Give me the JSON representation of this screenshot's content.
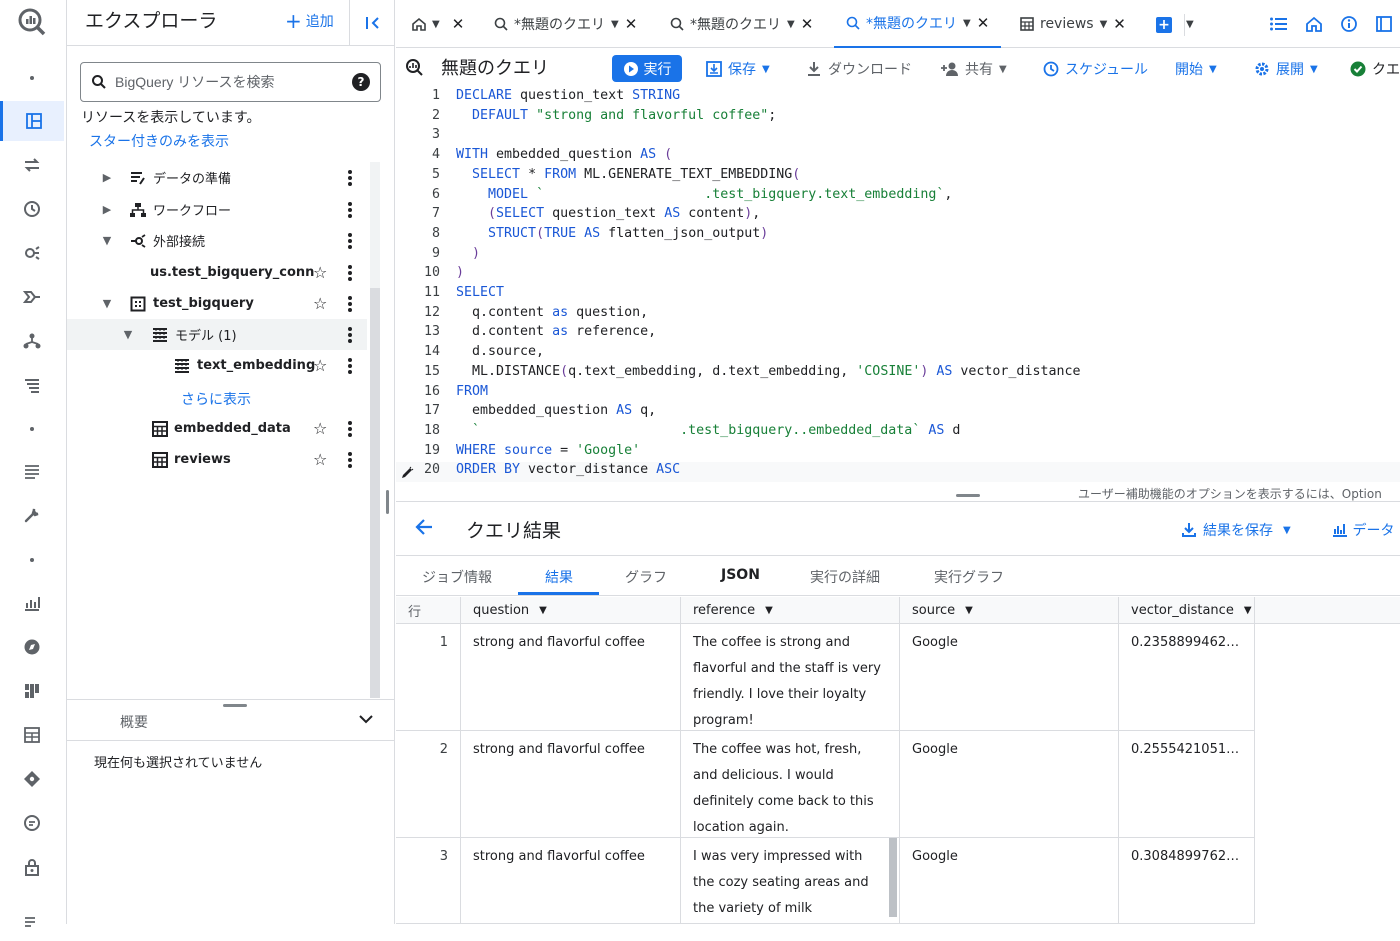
{
  "rail": {
    "items": [
      "dashboard-icon",
      "transfers-icon",
      "scheduled-icon",
      "analytics-icon",
      "pipeline-icon",
      "workflow-icon",
      "list-icon",
      "queue-icon",
      "wrench-icon",
      "chart-icon",
      "compass-icon",
      "dashboard2-icon",
      "table-icon",
      "diamond-icon",
      "feedback-icon",
      "lock-icon"
    ]
  },
  "explorer": {
    "title": "エクスプローラ",
    "add_label": "追加",
    "search_placeholder": "BigQuery リソースを検索",
    "status": "リソースを表示しています。",
    "starred_link": "スター付きのみを表示",
    "tree": [
      {
        "label": "データの準備",
        "icon": "data-prep-icon"
      },
      {
        "label": "ワークフロー",
        "icon": "workflow-icon"
      },
      {
        "label": "外部接続",
        "icon": "connection-icon"
      },
      {
        "label": "us.test_bigquery_conn"
      },
      {
        "label": "test_bigquery",
        "icon": "dataset-icon"
      },
      {
        "label": "モデル (1)",
        "icon": "model-group-icon"
      },
      {
        "label": "text_embedding",
        "icon": "model-icon"
      },
      {
        "label": "embedded_data",
        "icon": "table-icon"
      },
      {
        "label": "reviews",
        "icon": "table-icon"
      }
    ],
    "more_link": "さらに表示",
    "details_title": "概要",
    "details_empty": "現在何も選択されていません"
  },
  "tabs": [
    {
      "label": ""
    },
    {
      "label": "*無題のクエリ"
    },
    {
      "label": "*無題のクエリ"
    },
    {
      "label": "*無題のクエリ"
    },
    {
      "label": "reviews"
    }
  ],
  "toolbar": {
    "title": "無題のクエリ",
    "run": "実行",
    "save": "保存",
    "download": "ダウンロード",
    "share": "共有",
    "schedule": "スケジュール",
    "open": "開始",
    "deploy": "展開",
    "status": "クエ"
  },
  "editor": {
    "lines": [
      "1",
      "2",
      "3",
      "4",
      "5",
      "6",
      "7",
      "8",
      "9",
      "10",
      "11",
      "12",
      "13",
      "14",
      "15",
      "16",
      "17",
      "18",
      "19",
      "20"
    ],
    "a11y_hint": "ユーザー補助機能のオプションを表示するには、Option"
  },
  "results": {
    "title": "クエリ結果",
    "save": "結果を保存",
    "data": "データ",
    "tabs": [
      "ジョブ情報",
      "結果",
      "グラフ",
      "JSON",
      "実行の詳細",
      "実行グラフ"
    ],
    "columns": [
      "行",
      "question",
      "reference",
      "source",
      "vector_distance"
    ],
    "rows": [
      {
        "n": "1",
        "question": "strong and flavorful coffee",
        "reference": "The coffee is strong and flavorful and the staff is very friendly. I love their loyalty program!",
        "source": "Google",
        "distance": "0.235889946293…"
      },
      {
        "n": "2",
        "question": "strong and flavorful coffee",
        "reference": "The coffee was hot, fresh, and delicious. I would definitely come back to this location again.",
        "source": "Google",
        "distance": "0.255542105153…"
      },
      {
        "n": "3",
        "question": "strong and flavorful coffee",
        "reference": "I was very impressed with the cozy seating areas and the variety of milk",
        "source": "Google",
        "distance": "0.308489976237…"
      }
    ]
  }
}
